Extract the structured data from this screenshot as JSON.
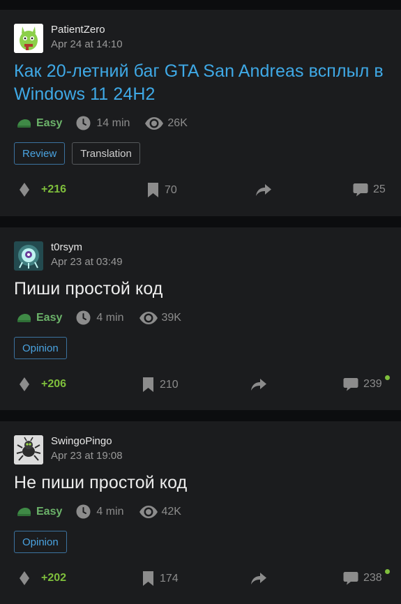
{
  "posts": [
    {
      "author": "PatientZero",
      "date": "Apr 24 at 14:10",
      "title": "Как 20-летний баг GTA San Andreas всплыл в Windows 11 24H2",
      "difficulty": "Easy",
      "read_time": "14 min",
      "views": "26K",
      "tags": [
        "Review",
        "Translation"
      ],
      "rating": "+216",
      "bookmarks": "70",
      "comments": "25",
      "new_comments": false
    },
    {
      "author": "t0rsym",
      "date": "Apr 23 at 03:49",
      "title": "Пиши простой код",
      "difficulty": "Easy",
      "read_time": "4 min",
      "views": "39K",
      "tags": [
        "Opinion"
      ],
      "rating": "+206",
      "bookmarks": "210",
      "comments": "239",
      "new_comments": true
    },
    {
      "author": "SwingoPingo",
      "date": "Apr 23 at 19:08",
      "title": "Не пиши простой код",
      "difficulty": "Easy",
      "read_time": "4 min",
      "views": "42K",
      "tags": [
        "Opinion"
      ],
      "rating": "+202",
      "bookmarks": "174",
      "comments": "238",
      "new_comments": true
    }
  ],
  "colors": {
    "title_link": "#3fa9e6",
    "easy": "#6cb36a",
    "rating": "#7fbf3c",
    "tag_blue": "#4aa3e0"
  },
  "icons": [
    "difficulty-icon",
    "clock-icon",
    "eye-icon",
    "rating-diamond-icon",
    "bookmark-icon",
    "share-icon",
    "comment-icon"
  ]
}
